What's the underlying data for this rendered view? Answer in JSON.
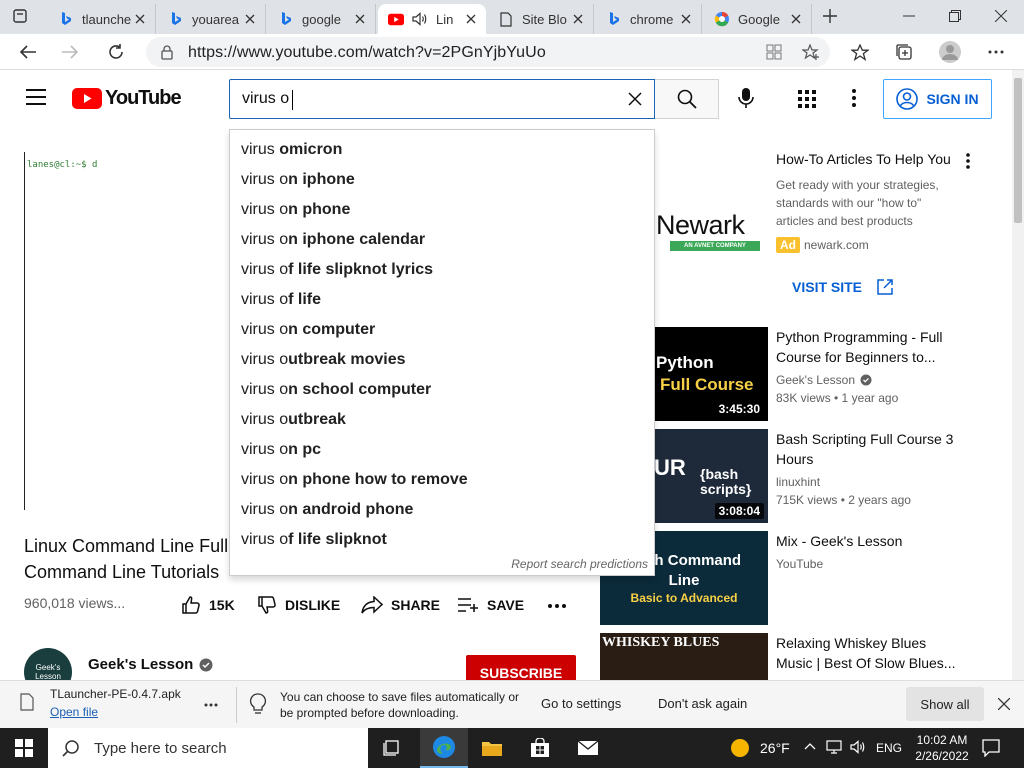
{
  "browser": {
    "tabs": [
      {
        "label": "tlaunche",
        "icon": "bing-icon"
      },
      {
        "label": "youarea",
        "icon": "bing-icon"
      },
      {
        "label": "google",
        "icon": "bing-icon"
      },
      {
        "label": "Lin",
        "icon": "youtube-icon"
      },
      {
        "label": "Site Blo",
        "icon": "page-icon"
      },
      {
        "label": "chrome",
        "icon": "bing-icon"
      },
      {
        "label": "Google",
        "icon": "google-icon"
      }
    ],
    "url": "https://www.youtube.com/watch?v=2PGnYjbYuUo"
  },
  "youtube": {
    "logo_text": "YouTube",
    "search_value": "virus o",
    "sign_in": "SIGN IN",
    "suggestions": [
      {
        "prefix": "virus ",
        "rest": "omicron"
      },
      {
        "prefix": "virus o",
        "rest": "n iphone"
      },
      {
        "prefix": "virus o",
        "rest": "n phone"
      },
      {
        "prefix": "virus o",
        "rest": "n iphone calendar"
      },
      {
        "prefix": "virus o",
        "rest": "f life slipknot lyrics"
      },
      {
        "prefix": "virus o",
        "rest": "f life"
      },
      {
        "prefix": "virus o",
        "rest": "n computer"
      },
      {
        "prefix": "virus o",
        "rest": "utbreak movies"
      },
      {
        "prefix": "virus o",
        "rest": "n school computer"
      },
      {
        "prefix": "virus o",
        "rest": "utbreak"
      },
      {
        "prefix": "virus o",
        "rest": "n pc"
      },
      {
        "prefix": "virus o",
        "rest": "n phone how to remove"
      },
      {
        "prefix": "virus o",
        "rest": "n android phone"
      },
      {
        "prefix": "virus o",
        "rest": "f life slipknot"
      }
    ],
    "report_predictions": "Report search predictions",
    "terminal_prompt": "lanes@cl:~$ d",
    "video_title": "Linux Command Line Full Command Line Tutorials",
    "views": "960,018 views...",
    "actions": {
      "like": "15K",
      "dislike": "DISLIKE",
      "share": "SHARE",
      "save": "SAVE"
    },
    "channel": {
      "name": "Geek's Lesson",
      "avatar_text": "Geek's Lesson"
    },
    "subscribe": "SUBSCRIBE",
    "ad": {
      "title": "How-To Articles To Help You",
      "description": "Get ready with your strategies, standards with our \"how to\" articles and best products",
      "badge": "Ad",
      "domain": "newark.com",
      "cta": "VISIT SITE",
      "logo_text": "Newark",
      "logo_sub": "AN AVNET COMPANY"
    },
    "related": [
      {
        "title": "Python Programming - Full Course for Beginners to...",
        "channel": "Geek's Lesson",
        "verified": true,
        "meta": "83K views • 1 year ago",
        "duration": "3:45:30",
        "thumb_line1": "Python",
        "thumb_line2": "Full Course"
      },
      {
        "title": "Bash Scripting Full Course 3 Hours",
        "channel": "linuxhint",
        "verified": false,
        "meta": "715K views • 2 years ago",
        "duration": "3:08:04",
        "thumb_line1": "UR",
        "thumb_line2": "{bash scripts}"
      },
      {
        "title": "Mix - Geek's Lesson",
        "channel": "YouTube",
        "verified": false,
        "meta": "",
        "duration": "",
        "thumb_line1": "Bash Command Line",
        "thumb_line2": "Basic to Advanced"
      },
      {
        "title": "Relaxing Whiskey Blues Music | Best Of Slow Blues...",
        "channel": "",
        "verified": false,
        "meta": "",
        "duration": "",
        "thumb_line1": "WHISKEY BLUES",
        "thumb_line2": ""
      }
    ]
  },
  "download": {
    "filename": "TLauncher-PE-0.4.7.apk",
    "open_file": "Open file",
    "message": "You can choose to save files automatically or be prompted before downloading.",
    "go_settings": "Go to settings",
    "dont_ask": "Don't ask again",
    "show_all": "Show all"
  },
  "taskbar": {
    "search_placeholder": "Type here to search",
    "weather": "26°F",
    "lang": "ENG",
    "time": "10:02 AM",
    "date": "2/26/2022"
  }
}
